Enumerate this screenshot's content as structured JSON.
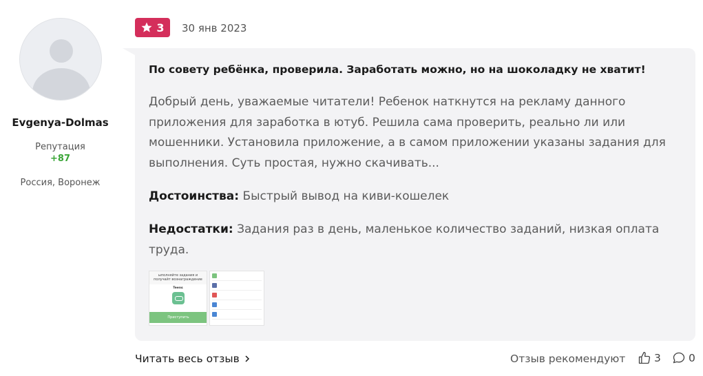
{
  "author": {
    "name": "Evgenya-Dolmas",
    "reputation_label": "Репутация",
    "reputation_value": "+87",
    "location": "Россия, Воронеж"
  },
  "review": {
    "rating": "3",
    "date": "30 янв 2023",
    "title": "По совету ребёнка, проверила. Заработать можно, но на шоколадку не хватит!",
    "excerpt": "Добрый день, уважаемые читатели! Ребенок наткнутся на рекламу данного приложения для заработка в ютуб. Решила сама проверить, реально ли или мошенники. Установила приложение, а в самом приложении указаны задания для выполнения. Суть простая, нужно скачивать...",
    "pros_label": "Достоинства:",
    "pros_text": "Быстрый вывод на киви-кошелек",
    "cons_label": "Недостатки:",
    "cons_text": "Задания раз в день, маленькое количество заданий, низкая оплата труда."
  },
  "thumbnail": {
    "caption": "ыполняйте задания и получайт вознаграждение",
    "app_name": "Teens",
    "button": "Приступить"
  },
  "footer": {
    "read_more": "Читать весь отзыв",
    "recommend_label": "Отзыв рекомендуют",
    "likes": "3",
    "comments": "0"
  },
  "colors": {
    "rating_badge": "#d42e5b",
    "reputation": "#3aa537",
    "card_bg": "#f3f3f5"
  }
}
